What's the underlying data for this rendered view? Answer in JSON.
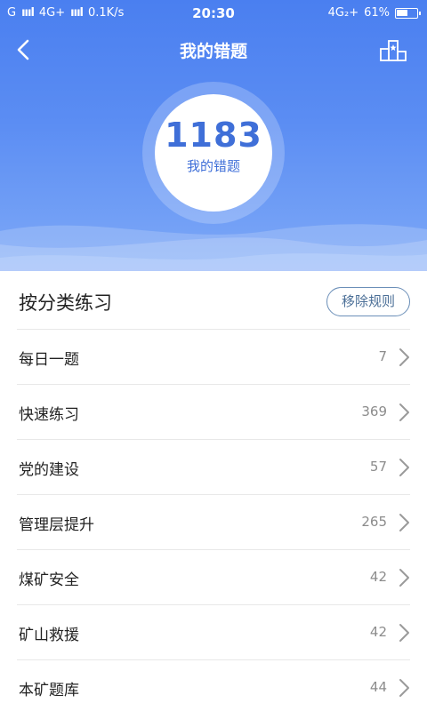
{
  "status_bar": {
    "carrier1": "G",
    "network2": "4G+",
    "speed": "0.1K/s",
    "time": "20:30",
    "network_right": "4G₂+",
    "battery": "61%",
    "battery_level": 0.61
  },
  "nav": {
    "title": "我的错题",
    "back_icon": "chevron-left-icon",
    "rank_icon": "podium-icon"
  },
  "summary": {
    "count": "1183",
    "label": "我的错题"
  },
  "section": {
    "title": "按分类练习",
    "rule_button": "移除规则"
  },
  "categories": [
    {
      "label": "每日一题",
      "count": "7"
    },
    {
      "label": "快速练习",
      "count": "369"
    },
    {
      "label": "党的建设",
      "count": "57"
    },
    {
      "label": "管理层提升",
      "count": "265"
    },
    {
      "label": "煤矿安全",
      "count": "42"
    },
    {
      "label": "矿山救援",
      "count": "42"
    },
    {
      "label": "本矿题库",
      "count": "44"
    }
  ],
  "colors": {
    "header_top": "#4a7ff0",
    "header_bottom": "#7ea9f7",
    "accent": "#3f6fd8",
    "rule_button_border": "#6b8fb8"
  }
}
